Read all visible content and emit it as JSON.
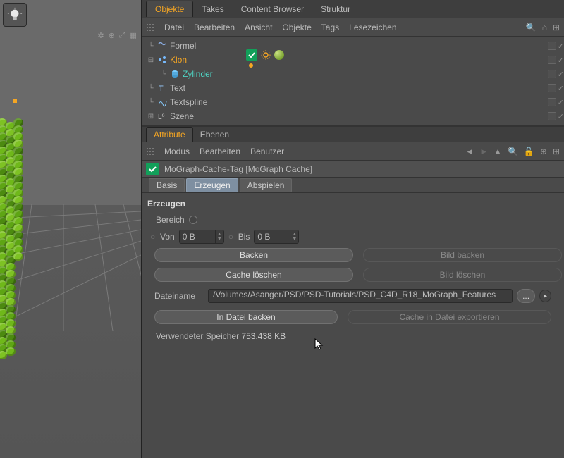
{
  "tabs": {
    "objects": "Objekte",
    "takes": "Takes",
    "content_browser": "Content Browser",
    "structure": "Struktur"
  },
  "menubar": {
    "file": "Datei",
    "edit": "Bearbeiten",
    "view": "Ansicht",
    "objects": "Objekte",
    "tags": "Tags",
    "bookmarks": "Lesezeichen"
  },
  "tree": {
    "formel": "Formel",
    "klon": "Klon",
    "zylinder": "Zylinder",
    "text": "Text",
    "textspline": "Textspline",
    "szene": "Szene"
  },
  "attr_tabs": {
    "attribute": "Attribute",
    "layers": "Ebenen"
  },
  "attr_menu": {
    "mode": "Modus",
    "edit": "Bearbeiten",
    "user": "Benutzer"
  },
  "tag_header": "MoGraph-Cache-Tag [MoGraph Cache]",
  "subtabs": {
    "basis": "Basis",
    "erzeugen": "Erzeugen",
    "abspielen": "Abspielen"
  },
  "section": {
    "title": "Erzeugen",
    "bereich": "Bereich",
    "von": "Von",
    "von_val": "0 B",
    "bis": "Bis",
    "bis_val": "0 B",
    "backen": "Backen",
    "bild_backen": "Bild backen",
    "cache_loeschen": "Cache löschen",
    "bild_loeschen": "Bild löschen",
    "dateiname": "Dateiname",
    "path": "/Volumes/Asanger/PSD/PSD-Tutorials/PSD_C4D_R18_MoGraph_Features",
    "in_datei_backen": "In Datei backen",
    "cache_export": "Cache in Datei exportieren",
    "mem_label": "Verwendeter Speicher",
    "mem_val": "753.438 KB",
    "browse": "..."
  }
}
